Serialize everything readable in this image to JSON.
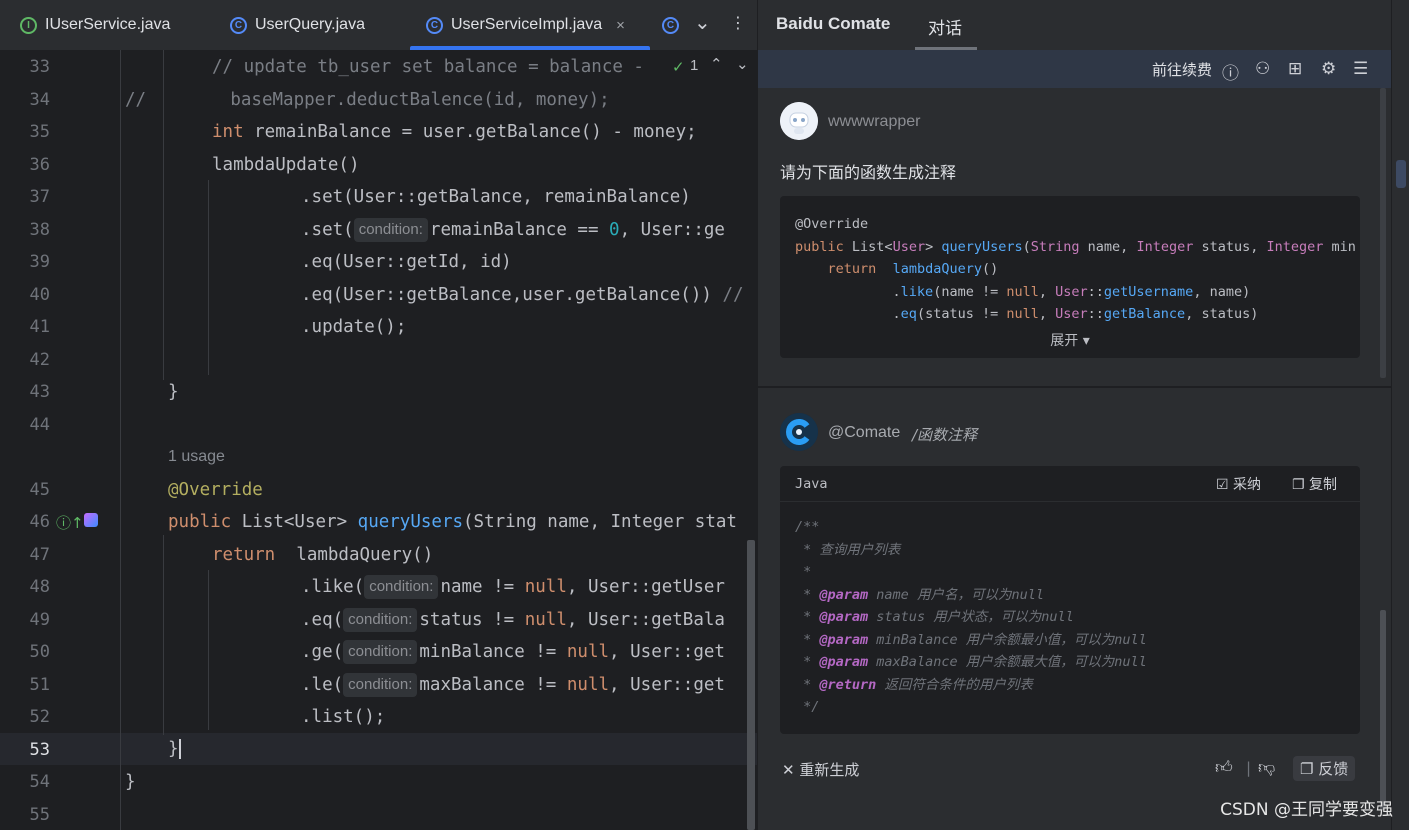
{
  "editor": {
    "tabs": [
      {
        "label": "IUserService.java",
        "icon": "interface-icon"
      },
      {
        "label": "UserQuery.java",
        "icon": "class-icon"
      },
      {
        "label": "UserServiceImpl.java",
        "icon": "class-icon",
        "active": true
      }
    ],
    "tab_close_glyph": "×",
    "more_glyph": "⋮",
    "chevron_glyph": "⌄",
    "line_numbers": [
      "33",
      "34",
      "35",
      "36",
      "37",
      "38",
      "39",
      "40",
      "41",
      "42",
      "43",
      "44",
      "45",
      "46",
      "47",
      "48",
      "49",
      "50",
      "51",
      "52",
      "53",
      "54",
      "55"
    ],
    "usage_text": "1 usage",
    "inspection_count": "1",
    "hint_label": "condition:",
    "current_line": "53"
  },
  "panel": {
    "tabs": [
      "Baidu Comate",
      "对话"
    ],
    "renew_label": "前往续费",
    "user": {
      "name": "wwwwrapper",
      "prompt": "请为下面的函数生成注释"
    },
    "expand_label": "展开 ▾",
    "bot": {
      "name": "@Comate",
      "command": "/函数注释"
    },
    "code_lang": "Java",
    "accept_label": "采纳",
    "copy_label": "复制",
    "regenerate_label": "重新生成",
    "feedback_label": "反馈"
  },
  "watermark": "CSDN @王同学要变强",
  "colors": {
    "accent": "#3574f0",
    "editor_bg": "#1e1f22",
    "panel_bg": "#2b2d30",
    "keyword": "#cf8e6d",
    "function": "#56a8f5"
  }
}
